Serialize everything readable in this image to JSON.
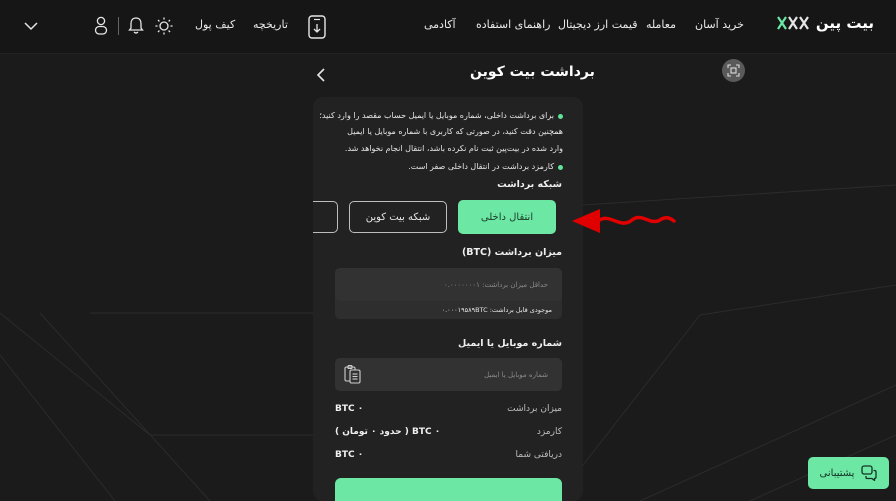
{
  "header": {
    "logo_text": "بیت پین",
    "nav": {
      "buy": "خرید آسان",
      "trade": "معامله",
      "prices": "قیمت ارز دیجیتال",
      "guide": "راهنمای استفاده",
      "academy": "آکادمی",
      "history": "تاریخچه",
      "wallet": "کیف پول"
    }
  },
  "page": {
    "title": "برداشت بیت کوین"
  },
  "notes": {
    "n1": "برای برداشت داخلی، شماره موبایل یا ایمیل حساب مقصد را وارد کنید؛",
    "n2": "همچنین دقت کنید، در صورتی که کاربری با شماره موبایل یا ایمیل",
    "n3": "وارد شده در بیت‌پین ثبت نام نکرده باشد، انتقال انجام نخواهد شد.",
    "n4": "کارمزد برداشت در انتقال داخلی صفر است."
  },
  "network": {
    "label": "شبکه برداشت",
    "internal": "انتقال داخلی",
    "bitcoin": "شبکه بیت کوین"
  },
  "amount": {
    "label": "میزان برداشت (BTC)",
    "placeholder": "حداقل میزان برداشت: ۰.۰۰۰۰۰۰۰۱",
    "balance": "موجودی قابل برداشت: ۰.۰۰۰۱۹۵۸۹BTC"
  },
  "recipient": {
    "label": "شماره موبایل یا ایمیل",
    "placeholder": "شماره موبایل یا ایمیل"
  },
  "summary": {
    "withdraw_k": "میزان برداشت",
    "withdraw_v": "BTC ۰",
    "fee_k": "کارمزد",
    "fee_v": "BTC ۰ ( حدود ۰ تومان )",
    "receive_k": "دریافتی شما",
    "receive_v": "BTC ۰"
  },
  "support": {
    "label": "پشتیبانی"
  },
  "colors": {
    "accent": "#6de8a4",
    "background": "#1b1b1b",
    "card": "#222222",
    "annotation_arrow": "#e00000"
  }
}
